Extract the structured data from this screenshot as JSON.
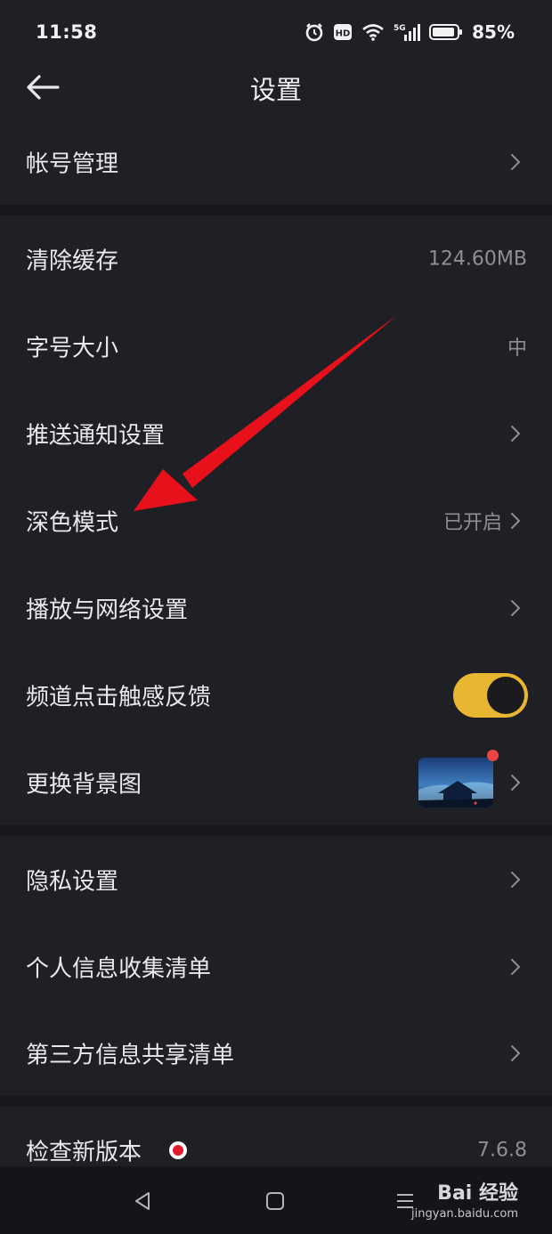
{
  "status_bar": {
    "time": "11:58",
    "hd_badge": "HD",
    "network": "5G",
    "battery_percent": "85%",
    "icons": [
      "alarm-icon",
      "hd-icon",
      "wifi-icon",
      "signal-5g-icon",
      "battery-icon"
    ]
  },
  "header": {
    "title": "设置",
    "back_icon": "arrow-left-icon"
  },
  "settings": {
    "account": {
      "label": "帐号管理"
    },
    "clear_cache": {
      "label": "清除缓存",
      "value": "124.60MB"
    },
    "font_size": {
      "label": "字号大小",
      "value": "中"
    },
    "push": {
      "label": "推送通知设置"
    },
    "dark_mode": {
      "label": "深色模式",
      "value": "已开启"
    },
    "playback": {
      "label": "播放与网络设置"
    },
    "haptic": {
      "label": "频道点击触感反馈",
      "toggle_on": true
    },
    "background": {
      "label": "更换背景图"
    },
    "privacy": {
      "label": "隐私设置"
    },
    "personal_info": {
      "label": "个人信息收集清单"
    },
    "third_party": {
      "label": "第三方信息共享清单"
    },
    "version": {
      "label": "检查新版本",
      "value": "7.6.8"
    }
  },
  "colors": {
    "background": "#1f2025",
    "separator": "#17181b",
    "toggle_on": "#e8b630",
    "annotation_arrow": "#e8101a",
    "badge_red": "#e21a2a"
  },
  "watermark": {
    "brand": "Bai 经验",
    "url": "jingyan.baidu.com"
  },
  "nav": {
    "icons": [
      "back-triangle-icon",
      "home-square-icon",
      "menu-lines-icon"
    ]
  }
}
